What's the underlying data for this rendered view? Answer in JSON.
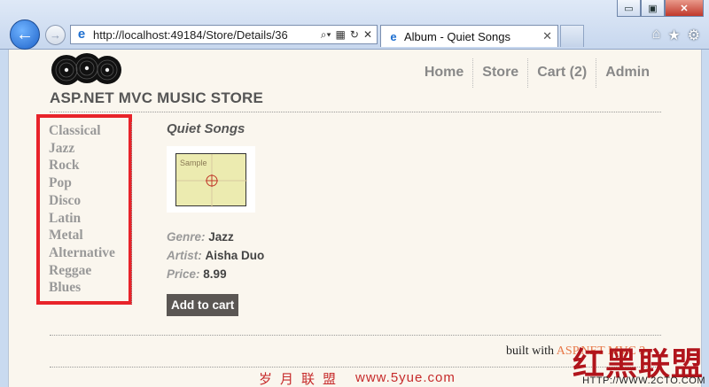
{
  "browser": {
    "url": "http://localhost:49184/Store/Details/36",
    "tab_title": "Album - Quiet Songs",
    "window_buttons": {
      "minimize": "▭",
      "maximize": "▣",
      "close": "✕"
    },
    "icons": [
      "back-arrow-icon",
      "forward-arrow-icon",
      "ie-logo-icon",
      "search-icon",
      "refresh-icon",
      "stop-icon",
      "home-icon",
      "favorites-star-icon",
      "settings-gear-icon"
    ]
  },
  "site": {
    "brand": "ASP.NET MVC MUSIC STORE",
    "nav": [
      {
        "label": "Home"
      },
      {
        "label": "Store"
      },
      {
        "label": "Cart (2)"
      },
      {
        "label": "Admin"
      }
    ]
  },
  "genres": [
    "Classical",
    "Jazz",
    "Rock",
    "Pop",
    "Disco",
    "Latin",
    "Metal",
    "Alternative",
    "Reggae",
    "Blues"
  ],
  "album": {
    "title": "Quiet Songs",
    "art_caption": "Sample",
    "genre_label": "Genre:",
    "genre": "Jazz",
    "artist_label": "Artist:",
    "artist": "Aisha Duo",
    "price_label": "Price:",
    "price": "8.99",
    "add_to_cart": "Add to cart"
  },
  "footer": {
    "prefix": "built with",
    "link": "ASP.NET MVC 3"
  },
  "watermark": {
    "big": "红黑联盟",
    "cn": "岁月联盟",
    "www": "www.5yue.com",
    "url": "HTTP://WWW.2CTO.COM"
  },
  "colors": {
    "highlight_border": "#e8232a",
    "page_bg": "#faf6ee",
    "button_bg": "#5a5653",
    "footer_link": "#e8794a"
  }
}
